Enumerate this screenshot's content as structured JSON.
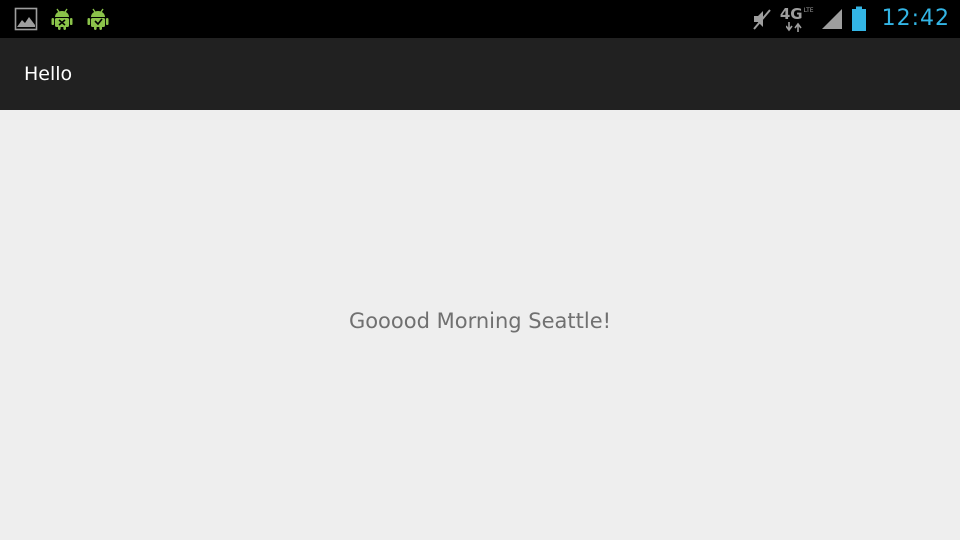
{
  "status_bar": {
    "notifications": [
      "image-notification-icon",
      "android-debug-icon",
      "android-debug-icon"
    ],
    "network_label": "4G",
    "network_sublabel": "LTE",
    "time": "12:42",
    "colors": {
      "background": "#000000",
      "clock": "#33b5e5",
      "icons": "#9e9e9e",
      "android_green": "#8bc34a"
    }
  },
  "action_bar": {
    "title": "Hello",
    "background": "#212121"
  },
  "main": {
    "greeting": "Gooood Morning Seattle!",
    "background": "#eeeeee"
  }
}
